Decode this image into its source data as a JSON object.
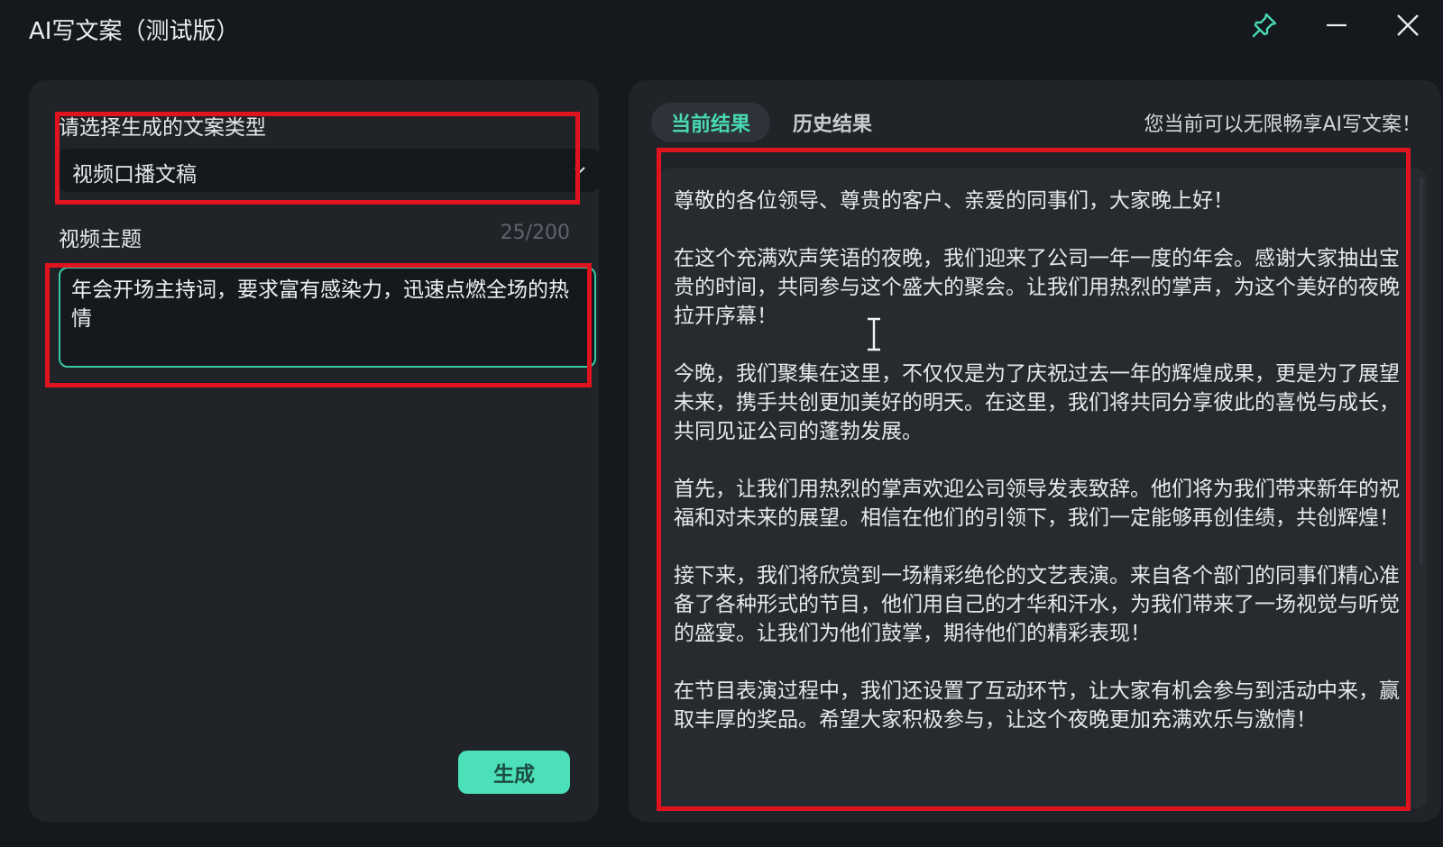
{
  "window": {
    "title": "AI写文案（测试版）",
    "controls": {
      "pin_icon": "pin-icon",
      "minimize_icon": "minimize-icon",
      "close_icon": "close-icon"
    }
  },
  "left_panel": {
    "type_label": "请选择生成的文案类型",
    "type_select_value": "视频口播文稿",
    "topic_label": "视频主题",
    "topic_counter": "25/200",
    "topic_text": "年会开场主持词，要求富有感染力，迅速点燃全场的热情",
    "generate_label": "生成"
  },
  "right_panel": {
    "tabs": [
      {
        "label": "当前结果",
        "active": true
      },
      {
        "label": "历史结果",
        "active": false
      }
    ],
    "notice": "您当前可以无限畅享AI写文案！",
    "result_paragraphs": [
      "尊敬的各位领导、尊贵的客户、亲爱的同事们，大家晚上好！",
      "在这个充满欢声笑语的夜晚，我们迎来了公司一年一度的年会。感谢大家抽出宝贵的时间，共同参与这个盛大的聚会。让我们用热烈的掌声，为这个美好的夜晚拉开序幕！",
      "今晚，我们聚集在这里，不仅仅是为了庆祝过去一年的辉煌成果，更是为了展望未来，携手共创更加美好的明天。在这里，我们将共同分享彼此的喜悦与成长，共同见证公司的蓬勃发展。",
      "首先，让我们用热烈的掌声欢迎公司领导发表致辞。他们将为我们带来新年的祝福和对未来的展望。相信在他们的引领下，我们一定能够再创佳绩，共创辉煌！",
      "接下来，我们将欣赏到一场精彩绝伦的文艺表演。来自各个部门的同事们精心准备了各种形式的节目，他们用自己的才华和汗水，为我们带来了一场视觉与听觉的盛宴。让我们为他们鼓掌，期待他们的精彩表现！",
      "在节目表演过程中，我们还设置了互动环节，让大家有机会参与到活动中来，赢取丰厚的奖品。希望大家积极参与，让这个夜晚更加充满欢乐与激情！"
    ]
  },
  "colors": {
    "background": "#15181c",
    "panel": "#202428",
    "accent": "#4bdfba",
    "highlight": "#e0141f"
  }
}
